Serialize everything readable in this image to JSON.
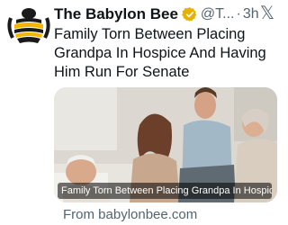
{
  "post": {
    "account_name": "The Babylon Bee",
    "handle": "@T...",
    "separator": "·",
    "time": "3h",
    "text": "Family Torn Between Placing Grandpa In Hospice And Having Him Run For Senate"
  },
  "card": {
    "caption": "Family Torn Between Placing Grandpa In Hospice An...",
    "source": "From babylonbee.com"
  },
  "icons": {
    "avatar": "babylon-bee-logo",
    "verified": "verified-badge-icon",
    "platform": "x-logo-icon"
  },
  "colors": {
    "verified_badge": "#e8b100",
    "secondary_text": "#536471",
    "primary_text": "#0f1419"
  },
  "brand": {
    "logo_letters": "BB"
  }
}
